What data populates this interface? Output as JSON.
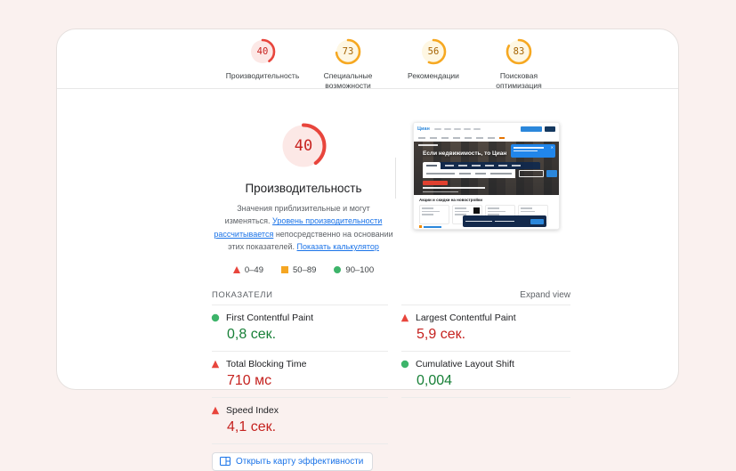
{
  "top_nav": {
    "categories": [
      {
        "score": "40",
        "label": "Производительность",
        "status": "fail"
      },
      {
        "score": "73",
        "label": "Специальные возможности",
        "status": "average"
      },
      {
        "score": "56",
        "label": "Рекомендации",
        "status": "average"
      },
      {
        "score": "83",
        "label": "Поисковая оптимизация",
        "status": "average"
      }
    ]
  },
  "main": {
    "score": "40",
    "title": "Производительность",
    "status": "fail",
    "desc_part1": "Значения приблизительные и могут изменяться. ",
    "desc_link1": "Уровень производительности рассчитывается",
    "desc_part2": " непосредственно на основании этих показателей. ",
    "desc_link2": "Показать калькулятор",
    "legend": [
      {
        "range": "0–49",
        "status": "fail"
      },
      {
        "range": "50–89",
        "status": "average"
      },
      {
        "range": "90–100",
        "status": "pass"
      }
    ]
  },
  "thumbnail": {
    "site_logo": "Циан",
    "hero_title": "Если недвижимость, то Циан",
    "promo_heading": "Акции и скидки на новостройки"
  },
  "metrics": {
    "header": "ПОКАЗАТЕЛИ",
    "expand_label": "Expand view",
    "left": [
      {
        "name": "First Contentful Paint",
        "value": "0,8 сек.",
        "status": "pass"
      },
      {
        "name": "Total Blocking Time",
        "value": "710 мс",
        "status": "fail"
      },
      {
        "name": "Speed Index",
        "value": "4,1 сек.",
        "status": "fail"
      }
    ],
    "right": [
      {
        "name": "Largest Contentful Paint",
        "value": "5,9 сек.",
        "status": "fail"
      },
      {
        "name": "Cumulative Layout Shift",
        "value": "0,004",
        "status": "pass"
      }
    ]
  },
  "treemap_button": {
    "label": "Открыть карту эффективности"
  },
  "colors": {
    "page_bg": "#faf1ef",
    "fail_arc": "#e8453c",
    "fail_text": "#c5221f",
    "average_arc": "#f6a821",
    "average_text": "#a56303",
    "pass_dot": "#3db46a",
    "pass_text": "#188038",
    "link_blue": "#1a73e8"
  }
}
